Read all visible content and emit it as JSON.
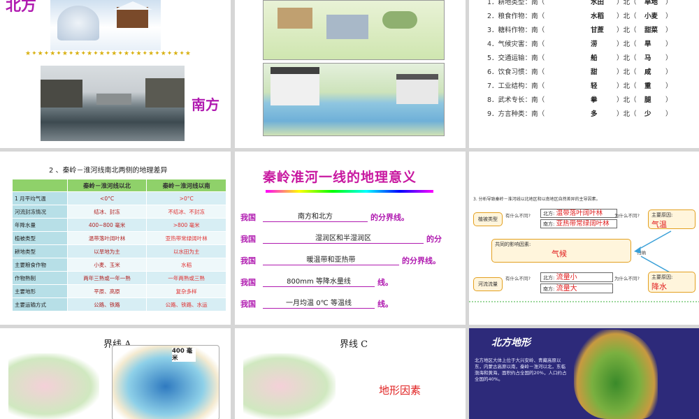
{
  "slide1": {
    "label_north": "北方",
    "label_south": "南方"
  },
  "slide3": {
    "items": [
      {
        "num": "1．",
        "name": "耕地类型",
        "south_ans": "水田",
        "north_ans": "旱地"
      },
      {
        "num": "2．",
        "name": "粮食作物",
        "south_ans": "水稻",
        "north_ans": "小麦"
      },
      {
        "num": "3．",
        "name": "糖料作物",
        "south_ans": "甘蔗",
        "north_ans": "甜菜"
      },
      {
        "num": "4．",
        "name": "气候灾害",
        "south_ans": "涝",
        "north_ans": "旱"
      },
      {
        "num": "5．",
        "name": "交通运输",
        "south_ans": "船",
        "north_ans": "马"
      },
      {
        "num": "6．",
        "name": "饮食习惯",
        "south_ans": "甜",
        "north_ans": "咸"
      },
      {
        "num": "7．",
        "name": "工业结构",
        "south_ans": "轻",
        "north_ans": "重"
      },
      {
        "num": "8．",
        "name": "武术专长",
        "south_ans": "拳",
        "north_ans": "腿"
      },
      {
        "num": "9．",
        "name": "方言种类",
        "south_ans": "多",
        "north_ans": "少"
      }
    ],
    "south_prefix": "：南（",
    "north_word": "）北（",
    "close": "）"
  },
  "slide4": {
    "title": "2 、秦岭－淮河线南北两侧的地理差异",
    "headers": [
      "",
      "秦岭－淮河线以北",
      "秦岭－淮河线以南"
    ],
    "rows": [
      [
        "1 月平均气温",
        "<0°C",
        ">0°C"
      ],
      [
        "河流封冻情况",
        "结冰、封冻",
        "不结冰、不封冻"
      ],
      [
        "年降水量",
        "400~800 毫米",
        ">800 毫米"
      ],
      [
        "植被类型",
        "温带落叶阔叶林",
        "亚热带常绿阔叶林"
      ],
      [
        "耕地类型",
        "以旱地为主",
        "以水田为主"
      ],
      [
        "主要粮食作物",
        "小麦、玉米",
        "水稻"
      ],
      [
        "作物熟制",
        "两年三熟或一年一熟",
        "一年两熟或三熟"
      ],
      [
        "主要地形",
        "平原、高原",
        "复杂多样"
      ],
      [
        "主要运输方式",
        "公路、铁路",
        "公路、铁路、水运"
      ]
    ]
  },
  "slide5": {
    "title": "秦岭淮河一线的地理意义",
    "prefix": "我国",
    "lines": [
      {
        "fill": "南方和北方",
        "suffix": "的分界线。"
      },
      {
        "fill": "湿润区和半湿润区",
        "suffix": "的分"
      },
      {
        "fill": "暖温带和亚热带",
        "suffix": "的分界线。"
      },
      {
        "fill": "800mm 等降水量线",
        "suffix": "线。"
      },
      {
        "fill": "一月均温 0℃ 等温线",
        "suffix": "线。"
      }
    ]
  },
  "slide6": {
    "title": "3. 分析导致秦岭－淮河线以北地区和以南地区自然差异的主导因素。",
    "box_veg": "植被类型",
    "box_river": "河流流量",
    "q1": "有什么不同?",
    "q2": "为什么不同?",
    "north_label": "北方:",
    "south_label": "南方:",
    "veg_north": "温带落叶阔叶林",
    "veg_south": "亚热带常绿阔叶林",
    "river_north": "流量小",
    "river_south": "流量大",
    "reason_label": "主要原因:",
    "reason_temp": "气温",
    "reason_rain": "降水",
    "common_label": "共同的影响因素:",
    "common_val": "气候",
    "induce": "归纳"
  },
  "slide7": {
    "title": "界线 A",
    "map_label": "400 毫米"
  },
  "slide8": {
    "title": "界线 C",
    "factor": "地形因素"
  },
  "slide9": {
    "title": "北方地形",
    "text": "北方地区大体上位于大兴安岭、青藏高原以东，内蒙古高原以南，秦岭－淮河以北，东临渤海和黄海，面积约占全国的20%，人口约占全国的40%。"
  },
  "colors": {
    "magenta": "#b01ab0",
    "red": "#e02020",
    "table_header": "#8fd16a",
    "table_label": "#b7dfe7"
  }
}
